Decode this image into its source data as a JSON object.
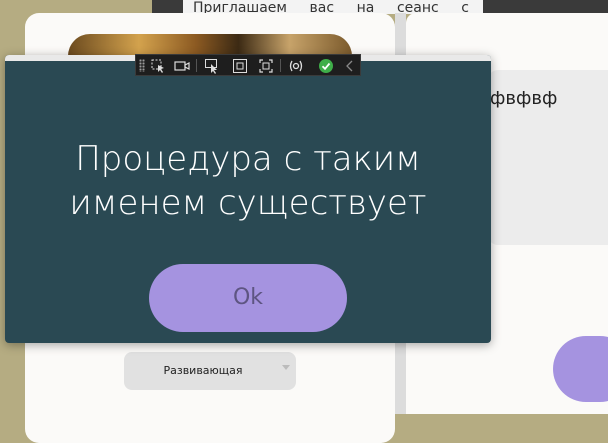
{
  "background_app": {
    "top_text": "Приглашаем вас на сеанс с",
    "right_panel_text": "фвфвф",
    "select": {
      "value": "Развивающая"
    }
  },
  "dialog": {
    "message_line1": "Процедура с таким",
    "message_line2": "именем существует",
    "ok_label": "Ok",
    "background_color": "#2a4953",
    "button_color": "#a593e0"
  },
  "devtools_toolbar": {
    "icons": [
      "grip-icon",
      "select-element-icon",
      "camera-icon",
      "pointer-icon",
      "display-layout-icon",
      "track-focus-icon",
      "hot-reload-icon",
      "binding-check-icon",
      "collapse-chevron-icon"
    ]
  }
}
